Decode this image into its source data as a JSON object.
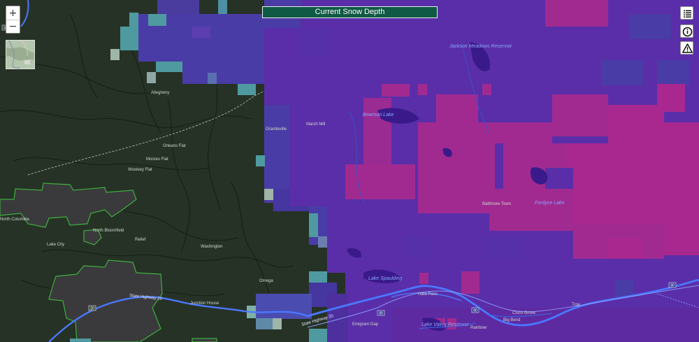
{
  "map": {
    "title": "Current Snow Depth",
    "controls": {
      "zoom_in": "+",
      "zoom_out": "−"
    },
    "places": [
      "Allegheny",
      "Graniteville",
      "Orleans Flat",
      "Moores Flat",
      "Woolsey Flat",
      "North Columbia",
      "North Bloomfield",
      "Relief",
      "Lake City",
      "Washington",
      "Omega",
      "Junction House",
      "Marsh Mill",
      "Baltimore Town",
      "Cisco Grove",
      "Big Bend",
      "Rainbow",
      "Yuba Pass",
      "Troy",
      "Emigrant Gap"
    ],
    "lakes": [
      "Jackson Meadows Reservoir",
      "Bowman Lake",
      "Fordyce Lake",
      "Lake Spaulding",
      "Lake Valley Reservoir"
    ],
    "highways": [
      "State Highway 20",
      "State Highway 20"
    ],
    "shields": [
      "49",
      "20",
      "80",
      "80",
      "80"
    ],
    "colors": {
      "title_bg": "#0f5a44",
      "terrain": "#263226",
      "snow_light": "#4f9aa0",
      "snow_medium": "#5a2ea8",
      "snow_deep": "#c0308f",
      "rivers": "#4a78ff",
      "boundary": "#3fae3f"
    }
  }
}
